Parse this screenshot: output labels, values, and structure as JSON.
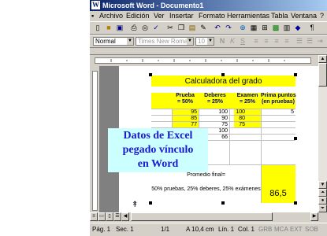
{
  "window": {
    "title": "Microsoft Word - Documento1",
    "app_icon": "W"
  },
  "menu": [
    "Archivo",
    "Edición",
    "Ver",
    "Insertar",
    "Formato",
    "Herramientas",
    "Tabla",
    "Ventana",
    "?"
  ],
  "format_bar": {
    "style": "Normal",
    "font": "Times New Roman",
    "size": "10"
  },
  "sheet": {
    "title": "Calculadora del grado",
    "headers": [
      {
        "line1": "Prueba",
        "line2": "= 50%"
      },
      {
        "line1": "Deberes",
        "line2": "= 25%"
      },
      {
        "line1": "Examen",
        "line2": "= 25%"
      },
      {
        "line1": "Prima puntos",
        "line2": "(en pruebas)"
      }
    ],
    "rows": [
      [
        "95",
        "100",
        "100",
        "5"
      ],
      [
        "85",
        "90",
        "80",
        ""
      ],
      [
        "77",
        "75",
        "75",
        ""
      ],
      [
        "",
        "100",
        "",
        ""
      ],
      [
        "",
        "66",
        "",
        ""
      ]
    ],
    "final_label": "Promedio final=",
    "formula_note": "50% pruebas, 25% deberes, 25% exámenes",
    "final_value": "86,5"
  },
  "callout": {
    "line1": "Datos de Excel",
    "line2": "pegado vínculo",
    "line3": "en Word"
  },
  "status": {
    "page": "Pág. 1",
    "section": "Sec. 1",
    "pages": "1/1",
    "at": "A 10,4 cm",
    "line": "Lín. 1",
    "col": "Col. 1",
    "modes": [
      "GRB",
      "MCA",
      "EXT",
      "SOB"
    ]
  },
  "colors": {
    "highlight": "#ffff00",
    "callout_bg": "#ccffff",
    "callout_text": "#1a1ad0",
    "title_bar": "#0a246a"
  }
}
